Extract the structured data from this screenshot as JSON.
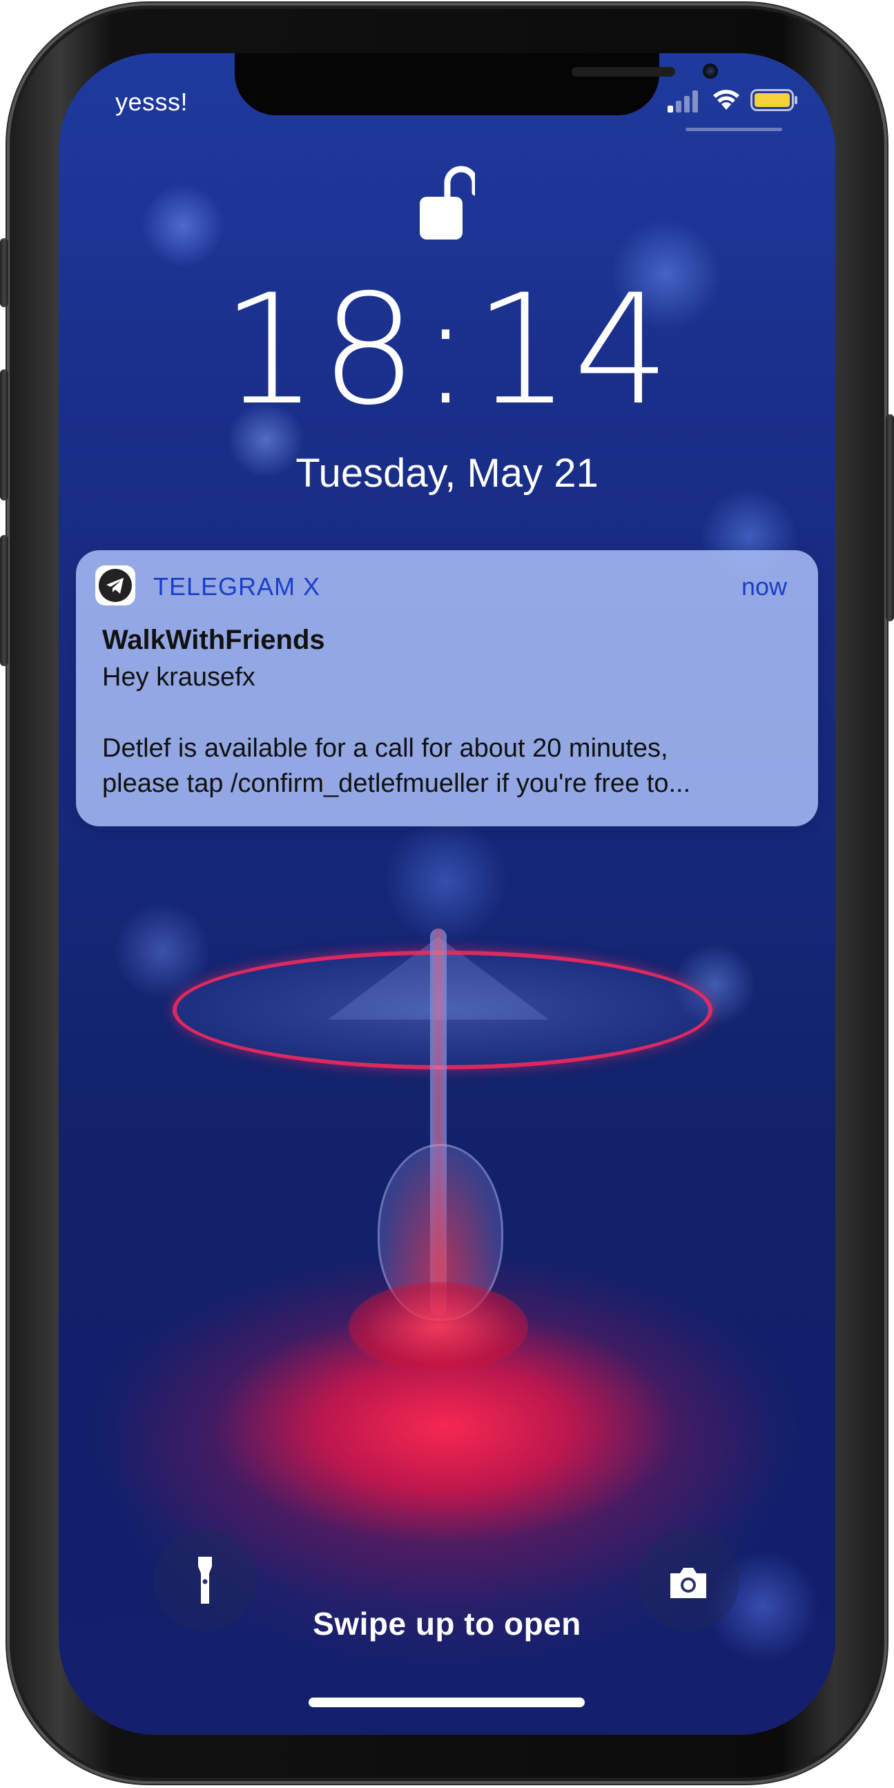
{
  "status_bar": {
    "carrier": "yesss!",
    "signal_icon": "signal-bars-icon",
    "wifi_icon": "wifi-icon",
    "battery_icon": "battery-icon",
    "battery_color": "#f5d23a"
  },
  "lock": {
    "icon": "unlocked-padlock-icon"
  },
  "clock": {
    "time": "18:14",
    "date": "Tuesday, May 21"
  },
  "notification": {
    "app_icon": "telegram-icon",
    "app_name": "TELEGRAM X",
    "time": "now",
    "title": "WalkWithFriends",
    "subtitle": "Hey krausefx",
    "body": "Detlef is available for a call for about 20 minutes,\nplease tap /confirm_detlefmueller if you're free to...",
    "accent_color": "#1a3ec8"
  },
  "bottom": {
    "flashlight_icon": "flashlight-icon",
    "camera_icon": "camera-icon",
    "swipe_label": "Swipe up to open"
  }
}
